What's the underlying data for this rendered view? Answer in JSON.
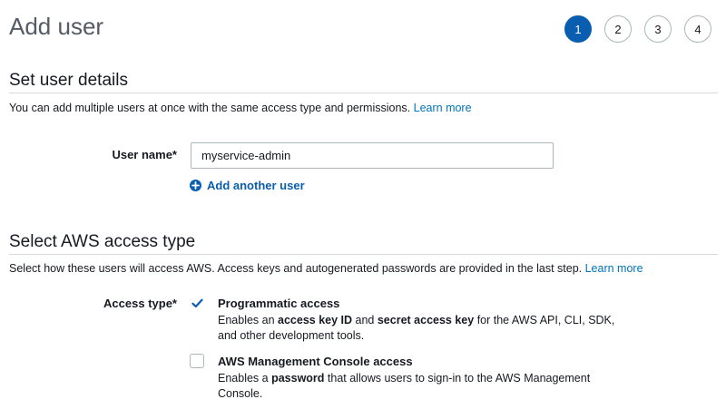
{
  "page_title": "Add user",
  "steps": [
    "1",
    "2",
    "3",
    "4"
  ],
  "active_step": "1",
  "details": {
    "title": "Set user details",
    "description": "You can add multiple users at once with the same access type and permissions.",
    "learn_more": "Learn more",
    "user_name_label": "User name*",
    "user_name_value": "myservice-admin",
    "add_another_user": "Add another user"
  },
  "access": {
    "title": "Select AWS access type",
    "description": "Select how these users will access AWS. Access keys and autogenerated passwords are provided in the last step.",
    "learn_more": "Learn more",
    "access_type_label": "Access type*",
    "options": [
      {
        "title": "Programmatic access",
        "checked": true,
        "desc_1": "Enables an ",
        "desc_bold_1": "access key ID",
        "desc_2": " and ",
        "desc_bold_2": "secret access key",
        "desc_3": " for the AWS API, CLI, SDK, and other development tools."
      },
      {
        "title": "AWS Management Console access",
        "checked": false,
        "desc_1": "Enables a ",
        "desc_bold_1": "password",
        "desc_2": " that allows users to sign-in to the AWS Management Console."
      }
    ]
  },
  "colors": {
    "accent": "#0a5eb0",
    "link": "#0073bb",
    "divider": "#d5dbdb"
  }
}
